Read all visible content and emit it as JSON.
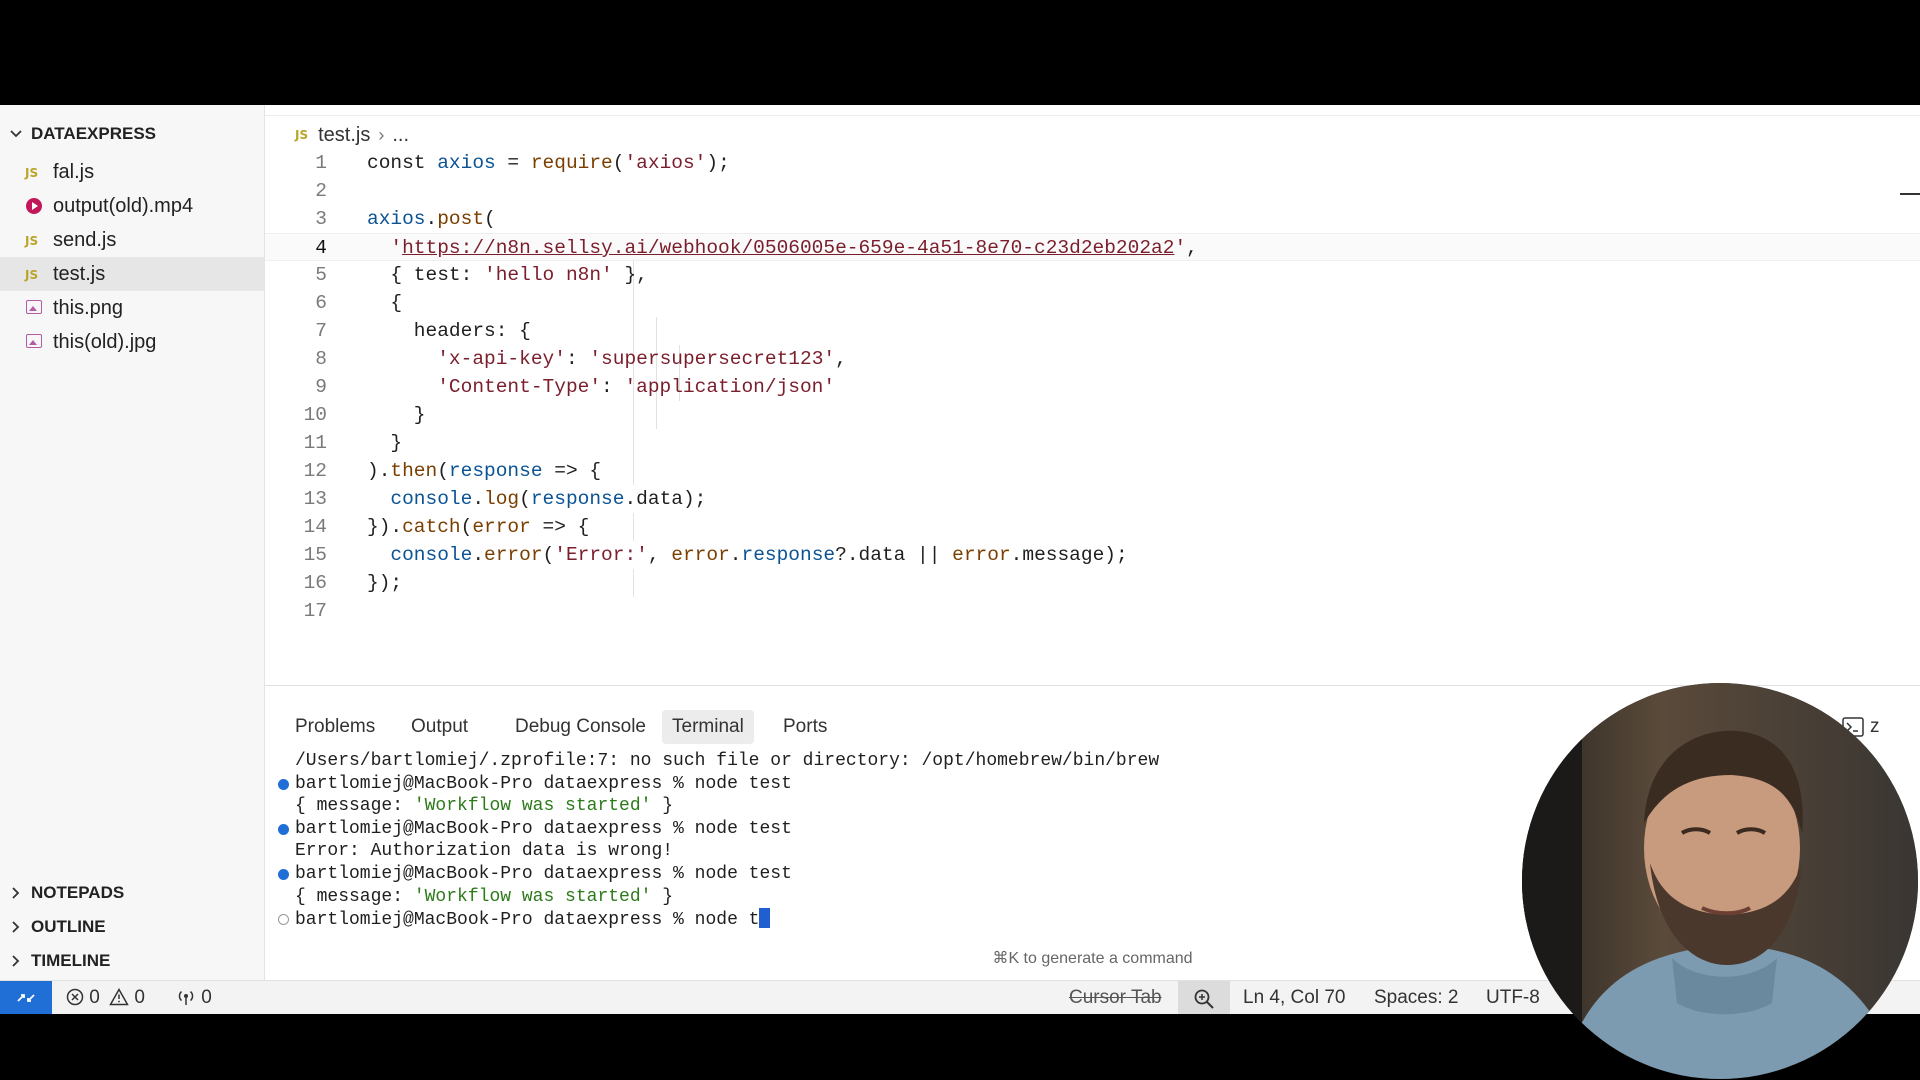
{
  "explorer": {
    "project": "DATAEXPRESS",
    "files": [
      {
        "name": "fal.js",
        "type": "js"
      },
      {
        "name": "output(old).mp4",
        "type": "video"
      },
      {
        "name": "send.js",
        "type": "js"
      },
      {
        "name": "test.js",
        "type": "js",
        "active": true
      },
      {
        "name": "this.png",
        "type": "image"
      },
      {
        "name": "this(old).jpg",
        "type": "image"
      }
    ],
    "icons": {
      "js": "JS",
      "video": "play-icon",
      "image": "image-icon"
    },
    "bottom_sections": [
      "NOTEPADS",
      "OUTLINE",
      "TIMELINE"
    ]
  },
  "editor": {
    "breadcrumb": {
      "badge": "JS",
      "file": "test.js",
      "rest": "..."
    },
    "current_line": 4,
    "lines": [
      {
        "n": "1",
        "text": "const axios = require('axios');"
      },
      {
        "n": "2",
        "text": ""
      },
      {
        "n": "3",
        "text": "axios.post("
      },
      {
        "n": "4",
        "text": "  'https://n8n.sellsy.ai/webhook/0506005e-659e-4a51-8e70-c23d2eb202a2',"
      },
      {
        "n": "5",
        "text": "  { test: 'hello n8n' },"
      },
      {
        "n": "6",
        "text": "  {"
      },
      {
        "n": "7",
        "text": "    headers: {"
      },
      {
        "n": "8",
        "text": "      'x-api-key': 'supersupersecret123',"
      },
      {
        "n": "9",
        "text": "      'Content-Type': 'application/json'"
      },
      {
        "n": "10",
        "text": "    }"
      },
      {
        "n": "11",
        "text": "  }"
      },
      {
        "n": "12",
        "text": ").then(response => {"
      },
      {
        "n": "13",
        "text": "  console.log(response.data);"
      },
      {
        "n": "14",
        "text": "}).catch(error => {"
      },
      {
        "n": "15",
        "text": "  console.error('Error:', error.response?.data || error.message);"
      },
      {
        "n": "16",
        "text": "});"
      },
      {
        "n": "17",
        "text": ""
      }
    ]
  },
  "panel": {
    "tabs": [
      "Problems",
      "Output",
      "Debug Console",
      "Terminal",
      "Ports"
    ],
    "active_tab": "Terminal",
    "terminal_label": "z",
    "terminal": [
      {
        "dot": "none",
        "text": "/Users/bartlomiej/.zprofile:7: no such file or directory: /opt/homebrew/bin/brew"
      },
      {
        "dot": "filled",
        "text": "bartlomiej@MacBook-Pro dataexpress % node test"
      },
      {
        "dot": "none",
        "pre": "{ message: ",
        "str": "'Workflow was started'",
        "post": " }"
      },
      {
        "dot": "filled",
        "text": "bartlomiej@MacBook-Pro dataexpress % node test"
      },
      {
        "dot": "none",
        "text": "Error: Authorization data is wrong!"
      },
      {
        "dot": "filled",
        "text": "bartlomiej@MacBook-Pro dataexpress % node test"
      },
      {
        "dot": "none",
        "pre": "{ message: ",
        "str": "'Workflow was started'",
        "post": " }"
      },
      {
        "dot": "empty",
        "text": "bartlomiej@MacBook-Pro dataexpress % node t",
        "cursor": true
      }
    ],
    "hint": "⌘K to generate a command"
  },
  "statusbar": {
    "errors": "0",
    "warnings": "0",
    "ports": "0",
    "cursor_tab": "Cursor Tab",
    "position": "Ln 4, Col 70",
    "spaces": "Spaces: 2",
    "encoding": "UTF-8"
  },
  "colors": {
    "accent": "#1f6fd6",
    "string": "#7b1e2c",
    "terminal_string": "#2c7a1a"
  }
}
